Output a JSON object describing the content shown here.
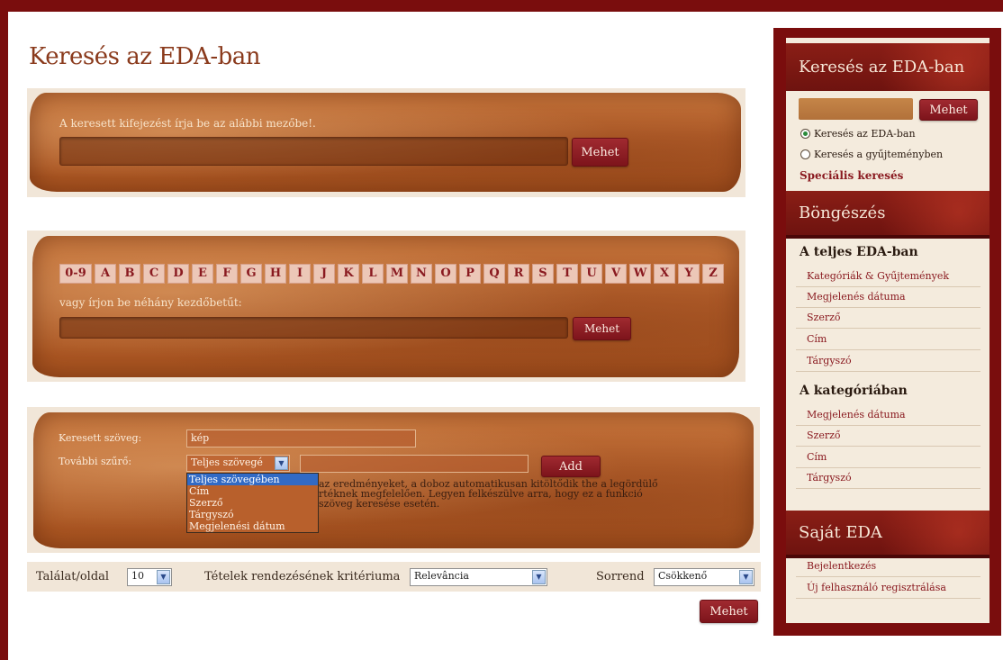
{
  "main": {
    "title": "Keresés az EDA-ban",
    "simple_search": {
      "label": "A keresett kifejezést írja be az alábbi mezőbe!.",
      "button": "Mehet"
    },
    "alpha_search": {
      "letters": [
        "0-9",
        "A",
        "B",
        "C",
        "D",
        "E",
        "F",
        "G",
        "H",
        "I",
        "J",
        "K",
        "L",
        "M",
        "N",
        "O",
        "P",
        "Q",
        "R",
        "S",
        "T",
        "U",
        "V",
        "W",
        "X",
        "Y",
        "Z"
      ],
      "prefix_label": "vagy írjon be néhány kezdőbetűt:",
      "button": "Mehet"
    },
    "advanced": {
      "searched_text_label": "Keresett szöveg:",
      "searched_text_value": "kép",
      "filter_label": "További szűrő:",
      "filter_selected": "Teljes szövegé",
      "add_button": "Add",
      "filter_options": [
        "Teljes szövegében",
        "Cím",
        "Szerző",
        "Tárgyszó",
        "Megjelenési dátum"
      ],
      "help_lines": [
        "az eredményeket, a doboz automatikusan kitöltődik the a legördülő",
        "rtéknek megfelelően. Legyen felkészülve arra, hogy ez a funkció",
        "szöveg keresése esetén."
      ]
    },
    "results_bar": {
      "per_page_label": "Találat/oldal",
      "per_page_value": "10",
      "sort_label": "Tételek rendezésének kritériuma",
      "sort_value": "Relevância",
      "order_label": "Sorrend",
      "order_value": "Csökkenő"
    },
    "submit_button": "Mehet"
  },
  "sidebar": {
    "search": {
      "title": "Keresés az EDA-ban",
      "button": "Mehet",
      "radio_options": [
        "Keresés az EDA-ban",
        "Keresés a gyűjteményben"
      ],
      "special_link": "Speciális keresés"
    },
    "browse": {
      "title": "Böngészés",
      "section1_title": "A teljes EDA-ban",
      "section1_items": [
        "Kategóriák & Gyűjtemények",
        "Megjelenés dátuma",
        "Szerző",
        "Cím",
        "Tárgyszó"
      ],
      "section2_title": "A kategóriában",
      "section2_items": [
        "Megjelenés dátuma",
        "Szerző",
        "Cím",
        "Tárgyszó"
      ]
    },
    "my_eda": {
      "title": "Saját EDA",
      "items": [
        "Bejelentkezés",
        "Új felhasználó regisztrálása"
      ]
    }
  },
  "colors": {
    "frame": "#7a0d0d",
    "accent_button": "#8f1d24",
    "link": "#8a1a20",
    "selection": "#316ac5"
  }
}
